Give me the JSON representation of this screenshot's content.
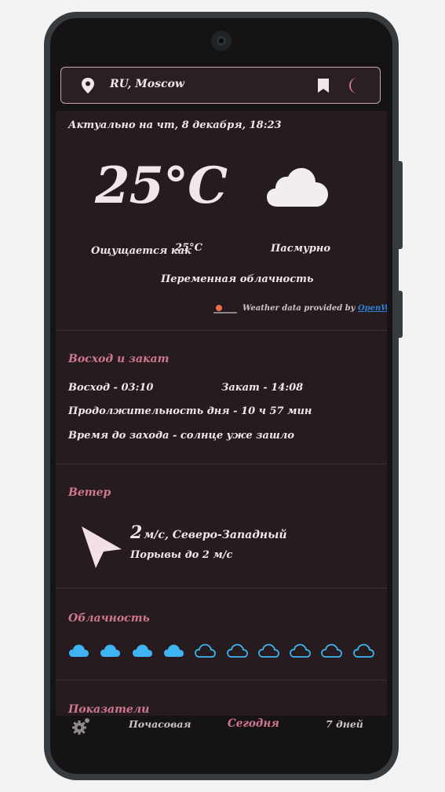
{
  "header": {
    "location": "RU, Moscow",
    "icons": [
      "location-pin-icon",
      "bookmark-icon",
      "moon-icon"
    ]
  },
  "current": {
    "updated": "Актуально на чт, 8 декабря, 18:23",
    "temp_value": "25",
    "temp_unit": "°C",
    "feels_label": "Ощущается как",
    "feels_value": "25°C",
    "condition": "Пасмурно",
    "description": "Переменная облачность",
    "attribution_text": "Weather data provided by",
    "attribution_link": "OpenWeather",
    "weather_icon": "cloud-icon"
  },
  "sun": {
    "title": "Восход и закат",
    "sunrise": "Восход - 03:10",
    "sunset": "Закат - 14:08",
    "day_length": "Продолжительность дня - 10 ч 57 мин",
    "time_to_sunset": "Время до захода - солнце уже зашло"
  },
  "wind": {
    "title": "Ветер",
    "speed": "2",
    "speed_text": "м/с, Северо-Западный",
    "gusts": "Порывы до 2 м/с"
  },
  "clouds": {
    "title": "Облачность",
    "level_filled": 4,
    "level_total": 10
  },
  "indicators": {
    "title": "Показатели"
  },
  "nav": {
    "hourly": "Почасовая",
    "today": "Сегодня",
    "week": "7 дней",
    "settings_icon": "gear-icon"
  },
  "colors": {
    "accent": "#d0788d",
    "text": "#f3e6ea",
    "card": "#261c1f",
    "cloud_blue": "#3fb4f2",
    "link": "#2e7fd8"
  }
}
